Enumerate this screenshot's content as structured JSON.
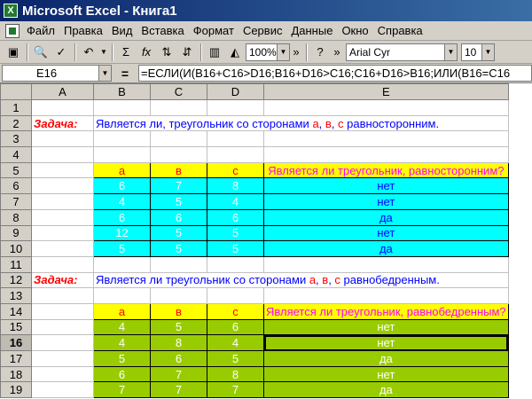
{
  "window": {
    "title": "Microsoft Excel - Книга1"
  },
  "menu": [
    "Файл",
    "Правка",
    "Вид",
    "Вставка",
    "Формат",
    "Сервис",
    "Данные",
    "Окно",
    "Справка"
  ],
  "toolbar": {
    "zoom": "100%",
    "font": "Arial Cyr",
    "size": "10"
  },
  "formula_bar": {
    "cell": "E16",
    "eq": "=",
    "formula": "=ЕСЛИ(И(B16+C16>D16;B16+D16>C16;C16+D16>B16;ИЛИ(B16=C16"
  },
  "columns": [
    "A",
    "B",
    "C",
    "D",
    "E"
  ],
  "rows": {
    "r2": {
      "label": "Задача:",
      "text1": "Является ли, треугольник со сторонами ",
      "a": "а",
      "sep1": ", ",
      "b": "в",
      "sep2": ", ",
      "c": "с",
      "text2": " равносторонним."
    },
    "r5": {
      "a": "а",
      "b": "в",
      "c": "с",
      "q": "Является ли треугольник, равносторонним?"
    },
    "table1": [
      {
        "a": "6",
        "b": "7",
        "c": "8",
        "r": "нет"
      },
      {
        "a": "4",
        "b": "5",
        "c": "4",
        "r": "нет"
      },
      {
        "a": "6",
        "b": "6",
        "c": "6",
        "r": "да"
      },
      {
        "a": "12",
        "b": "5",
        "c": "5",
        "r": "нет"
      },
      {
        "a": "5",
        "b": "5",
        "c": "5",
        "r": "да"
      }
    ],
    "r12": {
      "label": "Задача:",
      "text1": "Является ли треугольник со сторонами ",
      "a": "а",
      "sep1": ", ",
      "b": "в",
      "sep2": ", ",
      "c": "с",
      "text2": " равнобедренным."
    },
    "r14": {
      "a": "а",
      "b": "в",
      "c": "с",
      "q": "Является ли треугольник, равнобедренным?"
    },
    "table2": [
      {
        "a": "4",
        "b": "5",
        "c": "6",
        "r": "нет"
      },
      {
        "a": "4",
        "b": "8",
        "c": "4",
        "r": "нет"
      },
      {
        "a": "5",
        "b": "6",
        "c": "5",
        "r": "да"
      },
      {
        "a": "6",
        "b": "7",
        "c": "8",
        "r": "нет"
      },
      {
        "a": "7",
        "b": "7",
        "c": "7",
        "r": "да"
      }
    ]
  }
}
